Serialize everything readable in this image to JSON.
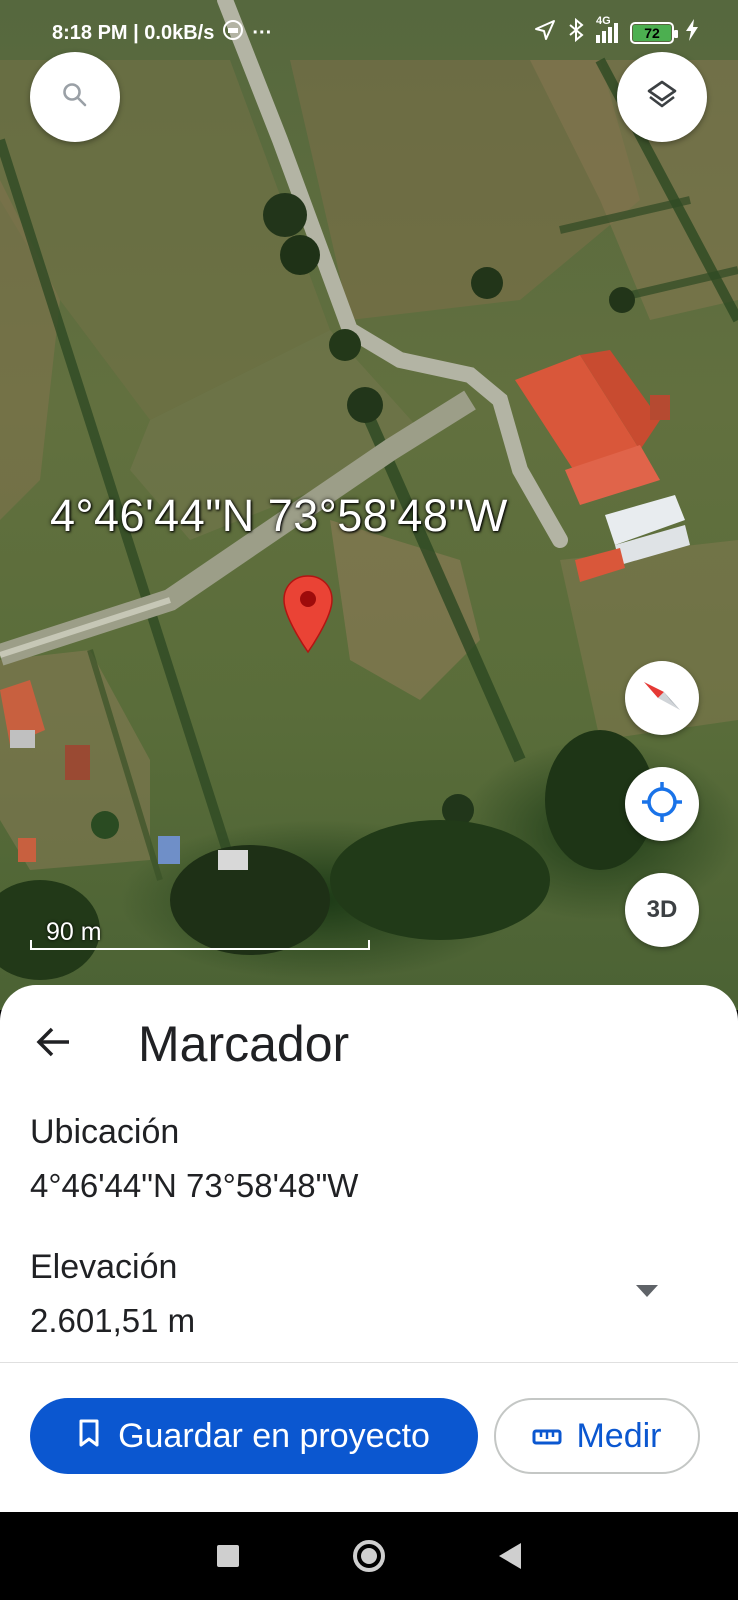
{
  "status_bar": {
    "time_speed": "8:18 PM | 0.0kB/s",
    "more_dots": "···",
    "network": "4G",
    "battery_level": "72"
  },
  "map": {
    "coordinates_overlay": "4°46'44\"N 73°58'48\"W",
    "scale_label": "90 m",
    "three_d_label": "3D"
  },
  "sheet": {
    "title": "Marcador",
    "location_label": "Ubicación",
    "location_value": "4°46'44\"N 73°58'48\"W",
    "elevation_label": "Elevación",
    "elevation_value": "2.601,51 m"
  },
  "actions": {
    "save_label": "Guardar en proyecto",
    "measure_label": "Medir"
  },
  "colors": {
    "primary_blue": "#0b57d0",
    "pin_red": "#ea4335",
    "roof_orange": "#d9573a"
  },
  "icons": [
    "search-icon",
    "layers-icon",
    "compass-icon",
    "my-location-icon",
    "back-arrow-icon",
    "bookmark-icon",
    "ruler-icon",
    "dropdown-arrow-icon",
    "map-pin-icon"
  ]
}
